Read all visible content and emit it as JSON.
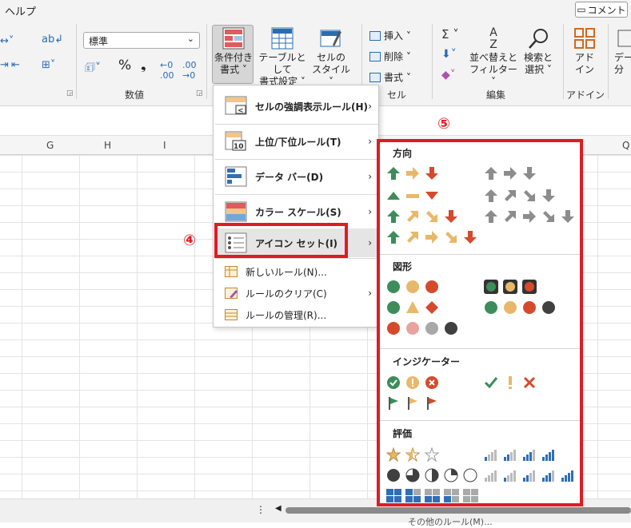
{
  "ribbon": {
    "tab_help": "ヘルプ",
    "comment_label": "コメント",
    "group_number_label": "数値",
    "group_cells_label": "セル",
    "group_edit_label": "編集",
    "group_addin_label": "アドイン",
    "number_format_value": "標準",
    "percent_label": "%",
    "comma_label": "❟",
    "conditional_format_label_1": "条件付き",
    "conditional_format_label_2": "書式 ˅",
    "format_as_table_label_1": "テーブルとして",
    "format_as_table_label_2": "書式設定 ˅",
    "cell_style_label_1": "セルの",
    "cell_style_label_2": "スタイル ˅",
    "insert_label": "挿入 ˅",
    "delete_label": "削除 ˅",
    "format_label": "書式 ˅",
    "sort_filter_label_1": "並べ替えと",
    "sort_filter_label_2": "フィルター ˅",
    "find_select_label_1": "検索と",
    "find_select_label_2": "選択 ˅",
    "addin_label_1": "アド",
    "addin_label_2": "イン",
    "data_analysis_label_1": "デー",
    "data_analysis_label_2": "分"
  },
  "sheet": {
    "columns": [
      "G",
      "H",
      "I",
      "Q"
    ]
  },
  "menu": {
    "items": [
      {
        "label": "セルの強調表示ルール(H)"
      },
      {
        "label": "上位/下位ルール(T)"
      },
      {
        "label": "データ バー(D)"
      },
      {
        "label": "カラー スケール(S)"
      },
      {
        "label": "アイコン セット(I)"
      },
      {
        "label": "新しいルール(N)..."
      },
      {
        "label": "ルールのクリア(C)"
      },
      {
        "label": "ルールの管理(R)..."
      }
    ],
    "annotation_4": "④"
  },
  "submenu": {
    "annotation_5": "⑤",
    "sections": [
      "方向",
      "図形",
      "インジケーター",
      "評価"
    ],
    "footer_partial": "その他のルール(M)..."
  },
  "colors": {
    "green": "#3c8d5a",
    "yellow": "#e8b86a",
    "red": "#d54a2d",
    "gray": "#8c8c8c",
    "blue": "#2f6fb5",
    "annotation_red": "#e01b24"
  }
}
